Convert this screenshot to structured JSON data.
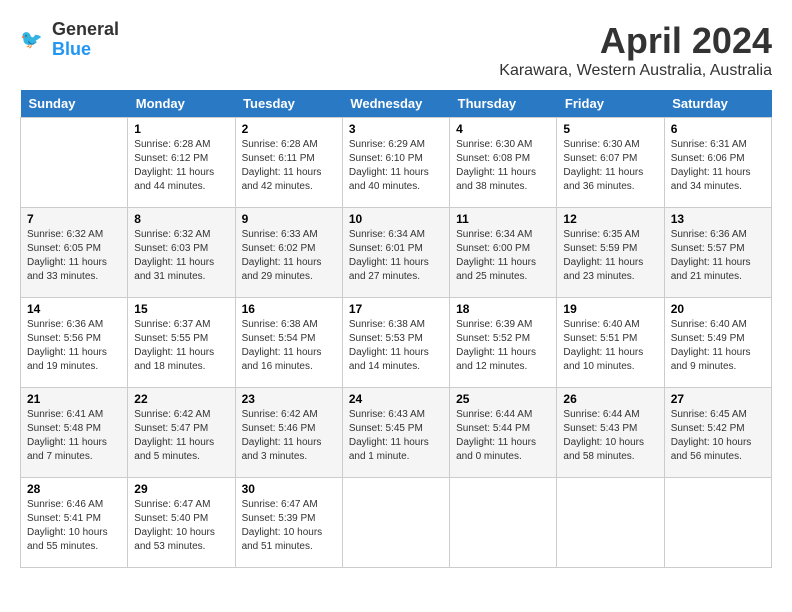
{
  "header": {
    "logo_line1": "General",
    "logo_line2": "Blue",
    "month_year": "April 2024",
    "location": "Karawara, Western Australia, Australia"
  },
  "days_of_week": [
    "Sunday",
    "Monday",
    "Tuesday",
    "Wednesday",
    "Thursday",
    "Friday",
    "Saturday"
  ],
  "weeks": [
    [
      {
        "day": "",
        "info": ""
      },
      {
        "day": "1",
        "info": "Sunrise: 6:28 AM\nSunset: 6:12 PM\nDaylight: 11 hours\nand 44 minutes."
      },
      {
        "day": "2",
        "info": "Sunrise: 6:28 AM\nSunset: 6:11 PM\nDaylight: 11 hours\nand 42 minutes."
      },
      {
        "day": "3",
        "info": "Sunrise: 6:29 AM\nSunset: 6:10 PM\nDaylight: 11 hours\nand 40 minutes."
      },
      {
        "day": "4",
        "info": "Sunrise: 6:30 AM\nSunset: 6:08 PM\nDaylight: 11 hours\nand 38 minutes."
      },
      {
        "day": "5",
        "info": "Sunrise: 6:30 AM\nSunset: 6:07 PM\nDaylight: 11 hours\nand 36 minutes."
      },
      {
        "day": "6",
        "info": "Sunrise: 6:31 AM\nSunset: 6:06 PM\nDaylight: 11 hours\nand 34 minutes."
      }
    ],
    [
      {
        "day": "7",
        "info": "Sunrise: 6:32 AM\nSunset: 6:05 PM\nDaylight: 11 hours\nand 33 minutes."
      },
      {
        "day": "8",
        "info": "Sunrise: 6:32 AM\nSunset: 6:03 PM\nDaylight: 11 hours\nand 31 minutes."
      },
      {
        "day": "9",
        "info": "Sunrise: 6:33 AM\nSunset: 6:02 PM\nDaylight: 11 hours\nand 29 minutes."
      },
      {
        "day": "10",
        "info": "Sunrise: 6:34 AM\nSunset: 6:01 PM\nDaylight: 11 hours\nand 27 minutes."
      },
      {
        "day": "11",
        "info": "Sunrise: 6:34 AM\nSunset: 6:00 PM\nDaylight: 11 hours\nand 25 minutes."
      },
      {
        "day": "12",
        "info": "Sunrise: 6:35 AM\nSunset: 5:59 PM\nDaylight: 11 hours\nand 23 minutes."
      },
      {
        "day": "13",
        "info": "Sunrise: 6:36 AM\nSunset: 5:57 PM\nDaylight: 11 hours\nand 21 minutes."
      }
    ],
    [
      {
        "day": "14",
        "info": "Sunrise: 6:36 AM\nSunset: 5:56 PM\nDaylight: 11 hours\nand 19 minutes."
      },
      {
        "day": "15",
        "info": "Sunrise: 6:37 AM\nSunset: 5:55 PM\nDaylight: 11 hours\nand 18 minutes."
      },
      {
        "day": "16",
        "info": "Sunrise: 6:38 AM\nSunset: 5:54 PM\nDaylight: 11 hours\nand 16 minutes."
      },
      {
        "day": "17",
        "info": "Sunrise: 6:38 AM\nSunset: 5:53 PM\nDaylight: 11 hours\nand 14 minutes."
      },
      {
        "day": "18",
        "info": "Sunrise: 6:39 AM\nSunset: 5:52 PM\nDaylight: 11 hours\nand 12 minutes."
      },
      {
        "day": "19",
        "info": "Sunrise: 6:40 AM\nSunset: 5:51 PM\nDaylight: 11 hours\nand 10 minutes."
      },
      {
        "day": "20",
        "info": "Sunrise: 6:40 AM\nSunset: 5:49 PM\nDaylight: 11 hours\nand 9 minutes."
      }
    ],
    [
      {
        "day": "21",
        "info": "Sunrise: 6:41 AM\nSunset: 5:48 PM\nDaylight: 11 hours\nand 7 minutes."
      },
      {
        "day": "22",
        "info": "Sunrise: 6:42 AM\nSunset: 5:47 PM\nDaylight: 11 hours\nand 5 minutes."
      },
      {
        "day": "23",
        "info": "Sunrise: 6:42 AM\nSunset: 5:46 PM\nDaylight: 11 hours\nand 3 minutes."
      },
      {
        "day": "24",
        "info": "Sunrise: 6:43 AM\nSunset: 5:45 PM\nDaylight: 11 hours\nand 1 minute."
      },
      {
        "day": "25",
        "info": "Sunrise: 6:44 AM\nSunset: 5:44 PM\nDaylight: 11 hours\nand 0 minutes."
      },
      {
        "day": "26",
        "info": "Sunrise: 6:44 AM\nSunset: 5:43 PM\nDaylight: 10 hours\nand 58 minutes."
      },
      {
        "day": "27",
        "info": "Sunrise: 6:45 AM\nSunset: 5:42 PM\nDaylight: 10 hours\nand 56 minutes."
      }
    ],
    [
      {
        "day": "28",
        "info": "Sunrise: 6:46 AM\nSunset: 5:41 PM\nDaylight: 10 hours\nand 55 minutes."
      },
      {
        "day": "29",
        "info": "Sunrise: 6:47 AM\nSunset: 5:40 PM\nDaylight: 10 hours\nand 53 minutes."
      },
      {
        "day": "30",
        "info": "Sunrise: 6:47 AM\nSunset: 5:39 PM\nDaylight: 10 hours\nand 51 minutes."
      },
      {
        "day": "",
        "info": ""
      },
      {
        "day": "",
        "info": ""
      },
      {
        "day": "",
        "info": ""
      },
      {
        "day": "",
        "info": ""
      }
    ]
  ]
}
